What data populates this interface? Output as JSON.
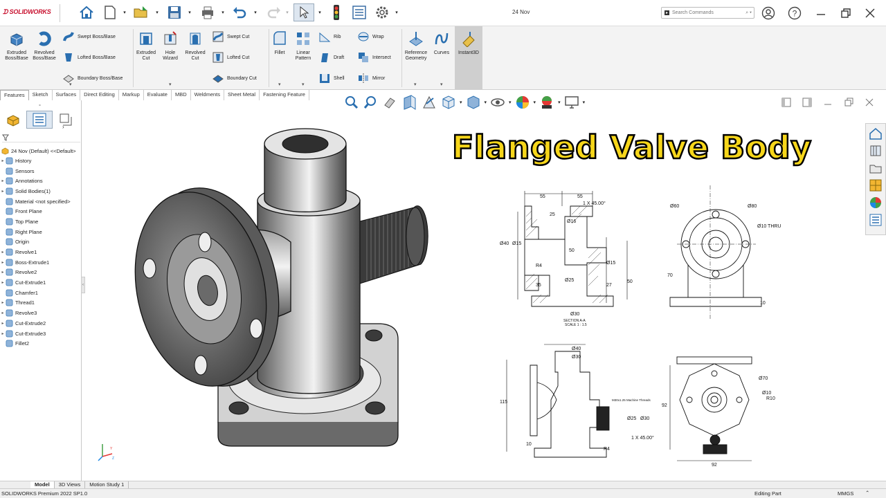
{
  "app": {
    "brand": "SOLIDWORKS",
    "doc_title": "24 Nov"
  },
  "search": {
    "placeholder": "Search Commands"
  },
  "ribbon": {
    "extruded_boss": "Extruded Boss/Base",
    "revolved_boss": "Revolved Boss/Base",
    "swept_boss": "Swept Boss/Base",
    "lofted_boss": "Lofted Boss/Base",
    "boundary_boss": "Boundary Boss/Base",
    "extruded_cut": "Extruded Cut",
    "hole_wizard": "Hole Wizard",
    "revolved_cut": "Revolved Cut",
    "swept_cut": "Swept Cut",
    "lofted_cut": "Lofted Cut",
    "boundary_cut": "Boundary Cut",
    "fillet": "Fillet",
    "linear_pattern": "Linear Pattern",
    "rib": "Rib",
    "draft": "Draft",
    "shell": "Shell",
    "wrap": "Wrap",
    "intersect": "Intersect",
    "mirror": "Mirror",
    "reference_geometry": "Reference Geometry",
    "curves": "Curves",
    "instant3d": "Instant3D"
  },
  "command_tabs": [
    "Features",
    "Sketch",
    "Surfaces",
    "Direct Editing",
    "Markup",
    "Evaluate",
    "MBD",
    "Weldments",
    "Sheet Metal",
    "Fastening Feature"
  ],
  "tree": {
    "root": "24 Nov (Default) <<Default>",
    "items": [
      {
        "label": "History",
        "arrow": "▸"
      },
      {
        "label": "Sensors",
        "arrow": ""
      },
      {
        "label": "Annotations",
        "arrow": "▸"
      },
      {
        "label": "Solid Bodies(1)",
        "arrow": "▸"
      },
      {
        "label": "Material <not specified>",
        "arrow": ""
      },
      {
        "label": "Front Plane",
        "arrow": ""
      },
      {
        "label": "Top Plane",
        "arrow": ""
      },
      {
        "label": "Right Plane",
        "arrow": ""
      },
      {
        "label": "Origin",
        "arrow": ""
      },
      {
        "label": "Revolve1",
        "arrow": "▸"
      },
      {
        "label": "Boss-Extrude1",
        "arrow": "▸"
      },
      {
        "label": "Revolve2",
        "arrow": "▸"
      },
      {
        "label": "Cut-Extrude1",
        "arrow": "▸"
      },
      {
        "label": "Chamfer1",
        "arrow": ""
      },
      {
        "label": "Thread1",
        "arrow": "▸"
      },
      {
        "label": "Revolve3",
        "arrow": "▸"
      },
      {
        "label": "Cut-Extrude2",
        "arrow": "▸"
      },
      {
        "label": "Cut-Extrude3",
        "arrow": "▸"
      },
      {
        "label": "Fillet2",
        "arrow": ""
      }
    ]
  },
  "banner": {
    "title": "Flanged Valve Body"
  },
  "drawing": {
    "d55a": "55",
    "d55b": "55",
    "chamfer1": "1 X 45.00°",
    "d25": "25",
    "dia16": "Ø16",
    "dia40": "Ø40",
    "dia15": "Ø15",
    "d50": "50",
    "r4": "R4",
    "dia15b": "Ø15",
    "dia25": "Ø25",
    "d35": "35",
    "d27": "27",
    "d50b": "50",
    "dia30": "Ø30",
    "section": "SECTION A-A",
    "scale": "SCALE 1 : 1.5",
    "dia60": "Ø60",
    "dia80": "Ø80",
    "dia10thru": "Ø10 THRU",
    "d70": "70",
    "d10": "10",
    "dia40b": "Ø40",
    "dia30b": "Ø30",
    "d115": "115",
    "thread": "M30x1.25 Machine Threads",
    "dia25b": "Ø25",
    "dia30c": "Ø30",
    "chamfer2": "1 X 45.00°",
    "d10b": "10",
    "r4b": "R4",
    "dia70": "Ø70",
    "dia10": "Ø10",
    "r10": "R10",
    "d92": "92",
    "d92b": "92"
  },
  "bottom_tabs": [
    "Model",
    "3D Views",
    "Motion Study 1"
  ],
  "status": {
    "left": "SOLIDWORKS Premium 2022 SP1.0",
    "editing": "Editing Part",
    "units": "MMGS"
  },
  "colors": {
    "brand": "#c8102e",
    "banner": "#f6d61a",
    "ribbon_bg": "#f3f3f3"
  }
}
